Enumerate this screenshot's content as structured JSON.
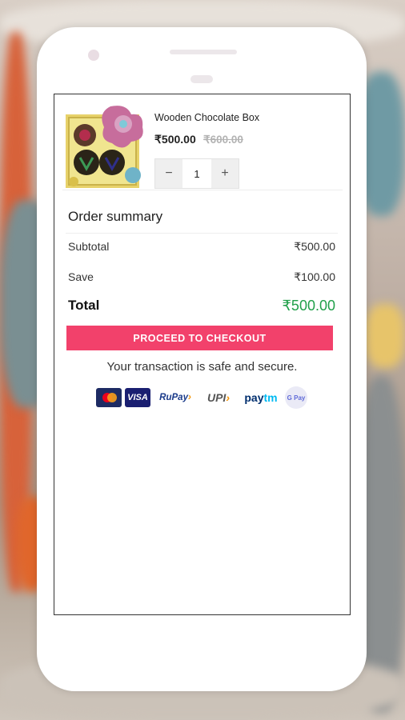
{
  "cart": {
    "item": {
      "name": "Wooden Chocolate Box",
      "price": "₹500.00",
      "original_price": "₹600.00",
      "quantity": "1",
      "minus": "−",
      "plus": "+"
    }
  },
  "summary": {
    "title": "Order summary",
    "subtotal_label": "Subtotal",
    "subtotal_value": "₹500.00",
    "save_label": "Save",
    "save_value": "₹100.00",
    "total_label": "Total",
    "total_value": "₹500.00"
  },
  "checkout_button": "PROCEED TO CHECKOUT",
  "secure_text": "Your transaction is safe and secure.",
  "payment_methods": {
    "visa": "VISA",
    "rupay_a": "RuPay",
    "rupay_b": "›",
    "upi_a": "UPI",
    "upi_b": "›",
    "paytm_a": "pay",
    "paytm_b": "tm",
    "gpay": "G Pay"
  },
  "colors": {
    "accent": "#f2416b",
    "total_green": "#21a04a"
  }
}
